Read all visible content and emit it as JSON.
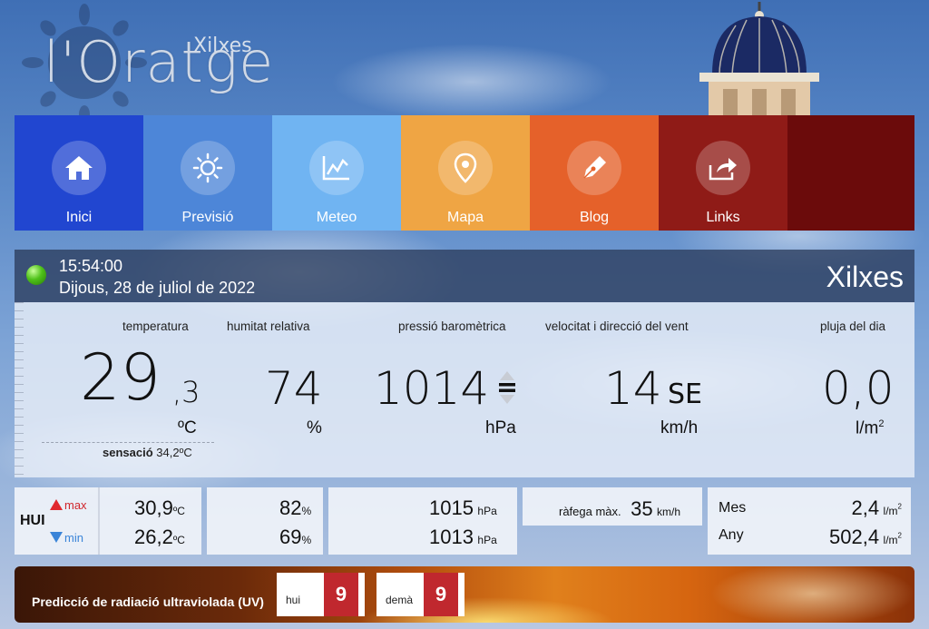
{
  "logo": {
    "title": "l'Oratge",
    "subtitle": "Xilxes"
  },
  "nav": [
    {
      "label": "Inici",
      "icon": "home-icon",
      "color": "#2146d0"
    },
    {
      "label": "Previsió",
      "icon": "sun-icon",
      "color": "#4d86d8"
    },
    {
      "label": "Meteo",
      "icon": "chart-icon",
      "color": "#70b4f2"
    },
    {
      "label": "Mapa",
      "icon": "map-pin-icon",
      "color": "#efa544"
    },
    {
      "label": "Blog",
      "icon": "pen-icon",
      "color": "#e5612a"
    },
    {
      "label": "Links",
      "icon": "share-icon",
      "color": "#8f1b17"
    }
  ],
  "station": {
    "time": "15:54:00",
    "date": "Dijous, 28 de juliol de 2022",
    "name": "Xilxes",
    "status_color": "#4fc21a"
  },
  "current": {
    "temperature": {
      "label": "temperatura",
      "int": "29",
      "dec": ",3",
      "unit": "ºC",
      "feels_label": "sensació",
      "feels_value": "34,2ºC"
    },
    "humidity": {
      "label": "humitat relativa",
      "value": "74",
      "unit": "%"
    },
    "pressure": {
      "label": "pressió baromètrica",
      "value": "1014",
      "trend": "=",
      "unit": "hPa"
    },
    "wind": {
      "label": "velocitat i direcció del vent",
      "value": "14",
      "dir": "SE",
      "unit": "km/h"
    },
    "rain": {
      "label": "pluja del dia",
      "value": "0,0",
      "unit": "l/m",
      "unit_sup": "2"
    }
  },
  "today": {
    "label": "HUI",
    "max_label": "max",
    "min_label": "min",
    "temp_max": "30,9",
    "temp_min": "26,2",
    "temp_unit": "ºC",
    "hum_max": "82",
    "hum_min": "69",
    "hum_unit": "%",
    "press_max": "1015",
    "press_min": "1013",
    "press_unit": "hPa",
    "gust_label": "ràfega màx.",
    "gust_value": "35",
    "gust_unit": "km/h",
    "rain_month_label": "Mes",
    "rain_month": "2,4",
    "rain_year_label": "Any",
    "rain_year": "502,4",
    "rain_unit": "l/m",
    "rain_unit_sup": "2"
  },
  "uv": {
    "title": "Predicció de radiació ultraviolada (UV)",
    "today_label": "hui",
    "today_value": "9",
    "tomorrow_label": "demà",
    "tomorrow_value": "9"
  }
}
